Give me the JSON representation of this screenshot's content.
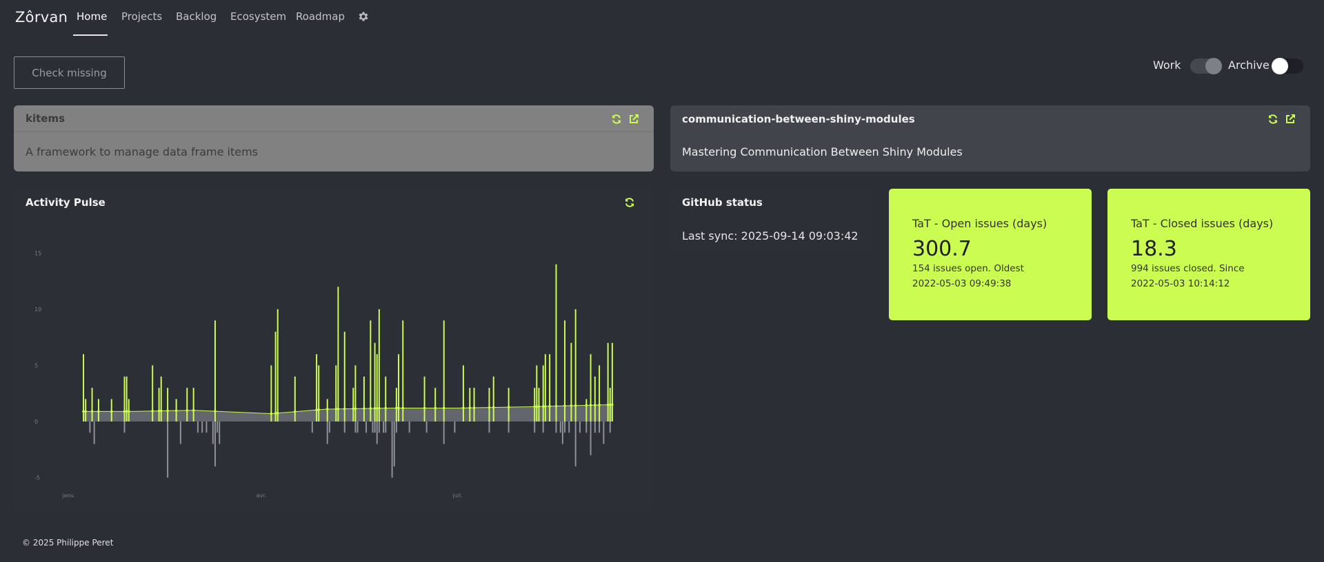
{
  "nav": {
    "brand": "Zôrvan",
    "links": [
      {
        "label": "Home",
        "active": true
      },
      {
        "label": "Projects",
        "active": false
      },
      {
        "label": "Backlog",
        "active": false
      },
      {
        "label": "Ecosystem",
        "active": false
      },
      {
        "label": "Roadmap",
        "active": false
      }
    ],
    "settings_icon": "gear-icon"
  },
  "controls": {
    "check_missing_label": "Check missing",
    "work_label": "Work",
    "work_on": true,
    "archive_label": "Archive",
    "archive_on": false
  },
  "projects": [
    {
      "name": "kitems",
      "description": "A framework to manage data frame items",
      "icons": [
        "refresh-icon",
        "external-link-icon"
      ]
    },
    {
      "name": "communication-between-shiny-modules",
      "description": "Mastering Communication Between Shiny Modules",
      "icons": [
        "refresh-icon",
        "external-link-icon"
      ]
    }
  ],
  "activity_pulse": {
    "title": "Activity Pulse",
    "refresh_icon": "refresh-icon"
  },
  "github_status": {
    "title": "GitHub status",
    "last_sync": "Last sync: 2025-09-14 09:03:42"
  },
  "tat": {
    "open": {
      "title": "TaT - Open issues (days)",
      "value": "300.7",
      "line1": "154 issues open. Oldest",
      "line2": "2022-05-03 09:49:38"
    },
    "closed": {
      "title": "TaT - Closed issues (days)",
      "value": "18.3",
      "line1": "994 issues closed. Since",
      "line2": "2022-05-03 10:14:12"
    }
  },
  "footer": "© 2025 Philippe Peret",
  "colors": {
    "accent": "#cbfc52",
    "background": "#2b2e35",
    "negative_bar": "#8f9196",
    "baseline_band": "#6d7075"
  },
  "chart_data": {
    "type": "bar",
    "title": "",
    "xlabel": "",
    "ylabel": "",
    "ylim": [
      -5,
      15
    ],
    "yticks": [
      "15",
      "10",
      "5",
      "0",
      "-5"
    ],
    "yticks_values": [
      15,
      10,
      5,
      0,
      -5
    ],
    "xtick_labels": [
      "janv.",
      "avr.",
      "juil."
    ],
    "xtick_days": [
      0,
      90,
      181
    ],
    "x_start": "2025-01-01",
    "x_end": "2025-09-14",
    "series": [
      {
        "name": "positive",
        "x": [
          "2025-01-09",
          "2025-01-10",
          "2025-01-13",
          "2025-01-16",
          "2025-01-22",
          "2025-01-28",
          "2025-01-29",
          "2025-01-30",
          "2025-02-10",
          "2025-02-13",
          "2025-02-14",
          "2025-02-17",
          "2025-02-21",
          "2025-02-26",
          "2025-03-01",
          "2025-03-11",
          "2025-04-06",
          "2025-04-08",
          "2025-04-09",
          "2025-04-17",
          "2025-04-27",
          "2025-04-28",
          "2025-05-02",
          "2025-05-06",
          "2025-05-07",
          "2025-05-10",
          "2025-05-14",
          "2025-05-15",
          "2025-05-19",
          "2025-05-22",
          "2025-05-24",
          "2025-05-25",
          "2025-05-26",
          "2025-05-29",
          "2025-06-03",
          "2025-06-04",
          "2025-06-06",
          "2025-06-16",
          "2025-06-21",
          "2025-06-25",
          "2025-07-04",
          "2025-07-07",
          "2025-07-09",
          "2025-07-16",
          "2025-07-18",
          "2025-07-25",
          "2025-08-06",
          "2025-08-07",
          "2025-08-08",
          "2025-08-10",
          "2025-08-11",
          "2025-08-13",
          "2025-08-16",
          "2025-08-20",
          "2025-08-23",
          "2025-08-25",
          "2025-08-30",
          "2025-09-01",
          "2025-09-03",
          "2025-09-05",
          "2025-09-09",
          "2025-09-10",
          "2025-09-11"
        ],
        "values": [
          6,
          2,
          3,
          2,
          2,
          4,
          4,
          2,
          5,
          3,
          4,
          3,
          2,
          3,
          3,
          9,
          5,
          8,
          10,
          4,
          6,
          5,
          2,
          5,
          12,
          8,
          3,
          5,
          4,
          9,
          7,
          6,
          10,
          4,
          3,
          6,
          9,
          4,
          3,
          9,
          5,
          3,
          3,
          3,
          4,
          3,
          3,
          5,
          3,
          5,
          6,
          6,
          14,
          9,
          7,
          10,
          2,
          6,
          4,
          5,
          7,
          3,
          7
        ]
      },
      {
        "name": "negative",
        "x": [
          "2025-01-12",
          "2025-01-14",
          "2025-01-28",
          "2025-02-17",
          "2025-02-23",
          "2025-03-03",
          "2025-03-05",
          "2025-03-07",
          "2025-03-10",
          "2025-03-11",
          "2025-03-12",
          "2025-03-13",
          "2025-04-25",
          "2025-05-02",
          "2025-05-03",
          "2025-05-10",
          "2025-05-15",
          "2025-05-16",
          "2025-05-20",
          "2025-05-23",
          "2025-05-24",
          "2025-05-25",
          "2025-05-26",
          "2025-05-28",
          "2025-05-29",
          "2025-06-01",
          "2025-06-02",
          "2025-06-03",
          "2025-06-09",
          "2025-06-17",
          "2025-06-25",
          "2025-06-30",
          "2025-07-16",
          "2025-07-25",
          "2025-08-06",
          "2025-08-10",
          "2025-08-16",
          "2025-08-18",
          "2025-08-19",
          "2025-08-20",
          "2025-08-22",
          "2025-08-25",
          "2025-08-27",
          "2025-08-30",
          "2025-09-01",
          "2025-09-03",
          "2025-09-05",
          "2025-09-07",
          "2025-09-10"
        ],
        "values": [
          -1,
          -2,
          -1,
          -5,
          -2,
          -1,
          -1,
          -1,
          -2,
          -4,
          -1,
          -2,
          -1,
          -2,
          -1,
          -1,
          -1,
          -1,
          -1,
          -1,
          -1,
          -2,
          -1,
          -1,
          -1,
          -5,
          -4,
          -1,
          -1,
          -1,
          -2,
          -1,
          -1,
          -1,
          -1,
          -1,
          -1,
          -1,
          -2,
          -1,
          -1,
          -4,
          -1,
          -1,
          -3,
          -1,
          -1,
          -2,
          -1
        ]
      },
      {
        "name": "trend",
        "x": [
          "2025-01-09",
          "2025-02-01",
          "2025-03-01",
          "2025-04-06",
          "2025-05-01",
          "2025-06-01",
          "2025-07-01",
          "2025-08-01",
          "2025-09-11"
        ],
        "values": [
          0.9,
          0.9,
          1.0,
          0.7,
          1.1,
          1.2,
          1.2,
          1.3,
          1.5
        ]
      }
    ],
    "grid": false
  }
}
